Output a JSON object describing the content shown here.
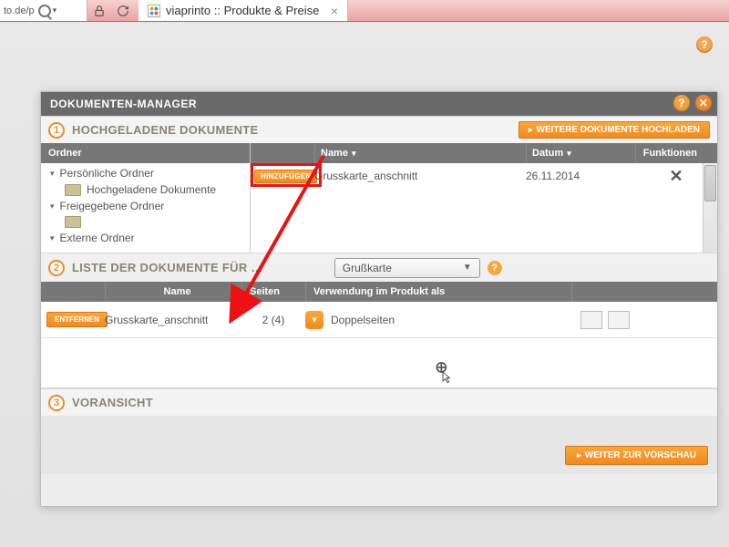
{
  "browser": {
    "url_fragment": "to.de/p",
    "tab_title": "viaprinto :: Produkte & Preise"
  },
  "modal": {
    "title": "DOKUMENTEN-MANAGER",
    "section1": {
      "step": "1",
      "title": "HOCHGELADENE DOKUMENTE",
      "upload_button": "WEITERE DOKUMENTE HOCHLADEN",
      "folder_header": "Ordner",
      "name_header": "Name",
      "date_header": "Datum",
      "functions_header": "Funktionen",
      "add_button": "HINZUFÜGEN",
      "folders": {
        "personal": "Persönliche Ordner",
        "uploaded": "Hochgeladene Dokumente",
        "shared": "Freigegebene Ordner",
        "external": "Externe Ordner"
      },
      "file": {
        "name": "Grusskarte_anschnitt",
        "date": "26.11.2014"
      }
    },
    "section2": {
      "step": "2",
      "title": "LISTE DER DOKUMENTE FÜR …",
      "product_select": "Grußkarte",
      "col_name": "Name",
      "col_pages": "Seiten",
      "col_usage": "Verwendung im Produkt als",
      "remove_button": "ENTFERNEN",
      "row": {
        "name": "Grusskarte_anschnitt",
        "pages": "2 (4)",
        "usage": "Doppelseiten"
      }
    },
    "section3": {
      "step": "3",
      "title": "VORANSICHT",
      "preview_button": "WEITER ZUR VORSCHAU"
    }
  }
}
